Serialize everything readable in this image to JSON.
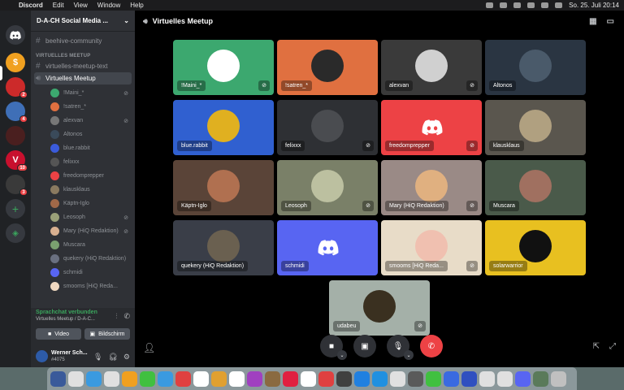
{
  "menubar": {
    "app": "Discord",
    "menus": [
      "Edit",
      "View",
      "Window",
      "Help"
    ],
    "clock": "So. 25. Juli  20:14"
  },
  "colors": {
    "accent": "#5865f2",
    "online": "#3ba55d",
    "danger": "#ed4245"
  },
  "rail": {
    "servers": [
      {
        "icon": "discord-home-icon",
        "color": "#36393f"
      },
      {
        "icon": "server-orange-icon",
        "color": "#f0a020"
      },
      {
        "icon": "server-flag-icon",
        "color": "#cc2a2a",
        "badge": "2"
      },
      {
        "icon": "server-blue-icon",
        "color": "#3f6fb7",
        "badge": "4"
      },
      {
        "icon": "server-red-icon",
        "color": "#4a1f1f"
      },
      {
        "icon": "server-v-icon",
        "color": "#c8102e",
        "badge": "10"
      },
      {
        "icon": "server-dark-icon",
        "color": "#3a3a3a",
        "badge": "3"
      }
    ]
  },
  "sidebar": {
    "guild": "D-A-CH Social Media ...",
    "channels_top": [
      "beehive-community"
    ],
    "category": "VIRTUELLES MEETUP",
    "text_channel": "virtuelles-meetup-text",
    "voice_channel": "Virtuelles Meetup",
    "voice_users": [
      {
        "name": "!Maini_*",
        "color": "#3ca86f",
        "muted": true
      },
      {
        "name": "!satren_*",
        "color": "#e07040",
        "muted": false
      },
      {
        "name": "alexvan",
        "color": "#777777",
        "muted": true
      },
      {
        "name": "Altonos",
        "color": "#3a4a5a",
        "muted": false
      },
      {
        "name": "blue.rabbit",
        "color": "#3b5bdb",
        "muted": false
      },
      {
        "name": "felixxx",
        "color": "#555555",
        "muted": false
      },
      {
        "name": "freedomprepper",
        "color": "#ed4245",
        "muted": false
      },
      {
        "name": "klausklaus",
        "color": "#8a7a60",
        "muted": false
      },
      {
        "name": "Käptn-Iglo",
        "color": "#a06848",
        "muted": false
      },
      {
        "name": "Leosoph",
        "color": "#9aa078",
        "muted": true
      },
      {
        "name": "Mary (HiQ Redaktion)",
        "color": "#d8b090",
        "muted": true
      },
      {
        "name": "Muscara",
        "color": "#7aa070",
        "muted": false
      },
      {
        "name": "quekery (HiQ Redaktion)",
        "color": "#6a7080",
        "muted": false
      },
      {
        "name": "schmidi",
        "color": "#5865f2",
        "muted": false
      },
      {
        "name": "smooms [HiQ Reda...",
        "color": "#f0d8c0",
        "muted": false
      }
    ],
    "voice_status": "Sprachchat verbunden",
    "voice_location": "Virtuelles Meetup / D-A-C...",
    "video_label": "Video",
    "screen_label": "Bildschirm",
    "user_name": "Werner Sch...",
    "user_tag": "#4075"
  },
  "stage": {
    "title": "Virtuelles Meetup",
    "tiles": [
      {
        "name": "!Maini_*",
        "bg": "#3ca86f",
        "av": "#ffffff",
        "muted": true,
        "logo": false
      },
      {
        "name": "!satren_*",
        "bg": "#e07040",
        "av": "#2a2a2a",
        "muted": false,
        "logo": false
      },
      {
        "name": "alexvan",
        "bg": "#3a3a3a",
        "av": "#d0d0d0",
        "muted": true,
        "logo": false
      },
      {
        "name": "Altonos",
        "bg": "#2a3542",
        "av": "#4a5a6a",
        "muted": false,
        "logo": false
      },
      {
        "name": "blue.rabbit",
        "bg": "#3060d0",
        "av": "#e0b020",
        "muted": false,
        "logo": false
      },
      {
        "name": "felixxx",
        "bg": "#2e3034",
        "av": "#4a4c50",
        "muted": true,
        "logo": false
      },
      {
        "name": "freedomprepper",
        "bg": "#ed4245",
        "av": "#ed4245",
        "muted": true,
        "logo": true
      },
      {
        "name": "klausklaus",
        "bg": "#5a564e",
        "av": "#b0a080",
        "muted": false,
        "logo": false
      },
      {
        "name": "Käptn-Iglo",
        "bg": "#5a4438",
        "av": "#b07050",
        "muted": false,
        "logo": false
      },
      {
        "name": "Leosoph",
        "bg": "#7a8068",
        "av": "#bcc0a0",
        "muted": true,
        "logo": false
      },
      {
        "name": "Mary (HiQ Redaktion)",
        "bg": "#9a8a86",
        "av": "#e0b080",
        "muted": true,
        "logo": false
      },
      {
        "name": "Muscara",
        "bg": "#4a5a4a",
        "av": "#a07060",
        "muted": false,
        "logo": false
      },
      {
        "name": "quekery (HiQ Redaktion)",
        "bg": "#3a3e48",
        "av": "#6a6050",
        "muted": false,
        "logo": false
      },
      {
        "name": "schmidi",
        "bg": "#5865f2",
        "av": "#5865f2",
        "muted": false,
        "logo": true
      },
      {
        "name": "smooms [HiQ Reda...",
        "bg": "#e8dcc8",
        "av": "#f0c0b0",
        "muted": true,
        "logo": false
      },
      {
        "name": "solarwarrior",
        "bg": "#e8c020",
        "av": "#111111",
        "muted": false,
        "logo": false
      },
      {
        "name": "udabeu",
        "bg": "#a4b0a8",
        "av": "#3a3020",
        "muted": true,
        "logo": false
      }
    ]
  },
  "dock": {
    "apps": [
      "#3a5a9a",
      "#e0e0e0",
      "#3a9ae0",
      "#e0e0e0",
      "#f0a020",
      "#40c040",
      "#3a9ae0",
      "#e04040",
      "#ffffff",
      "#e0a030",
      "#ffffff",
      "#a040c0",
      "#8a6a40",
      "#e02040",
      "#ffffff",
      "#e04040",
      "#404040",
      "#2080e0",
      "#2090e0",
      "#e0e0e0",
      "#5a5a5a",
      "#40c040",
      "#3a6ae0",
      "#3050c0",
      "#e0e0e0",
      "#e0e0e0",
      "#5865f2",
      "#5a7a5a",
      "#c0c0c0"
    ]
  }
}
